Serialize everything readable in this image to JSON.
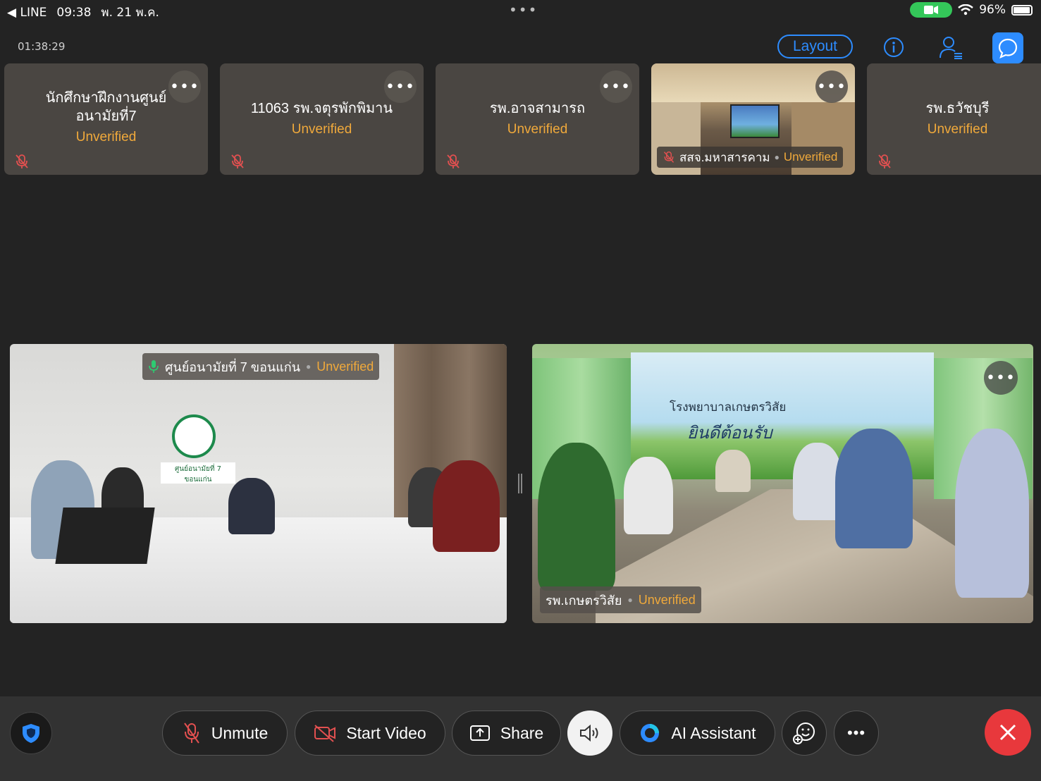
{
  "status_bar": {
    "back_app": "◀ LINE",
    "time": "09:38",
    "date": "พ. 21 พ.ค.",
    "center_dots": "•••",
    "battery": "96%"
  },
  "meeting": {
    "timer": "01:38:29",
    "layout_label": "Layout"
  },
  "thumbnails": [
    {
      "name": "นักศึกษาฝึกงานศูนย์อนามัยที่7",
      "status": "Unverified"
    },
    {
      "name": "11063 รพ.จตุรพักพิมาน",
      "status": "Unverified"
    },
    {
      "name": "รพ.อาจสามารถ",
      "status": "Unverified"
    },
    {
      "name": "สสจ.มหาสารคาม",
      "status": "Unverified"
    },
    {
      "name": "รพ.ธวัชบุรี",
      "status": "Unverified"
    }
  ],
  "more_glyph": "•••",
  "main_videos": {
    "left": {
      "name": "ศูนย์อนามัยที่ 7 ขอนแก่น",
      "status": "Unverified",
      "sign": "ศูนย์อนามัยที่ 7 ขอนแก่น"
    },
    "right": {
      "name": "รพ.เกษตรวิสัย",
      "status": "Unverified",
      "banner_line1": "โรงพยาบาลเกษตรวิสัย",
      "banner_line2": "ยินดีต้อนรับ"
    }
  },
  "toolbar": {
    "unmute_label": "Unmute",
    "start_video_label": "Start Video",
    "share_label": "Share",
    "ai_label": "AI Assistant"
  },
  "colors": {
    "accent": "#2d8cff",
    "unverified": "#f0a93b",
    "end": "#e8383c",
    "muted_icon": "#e25050"
  }
}
